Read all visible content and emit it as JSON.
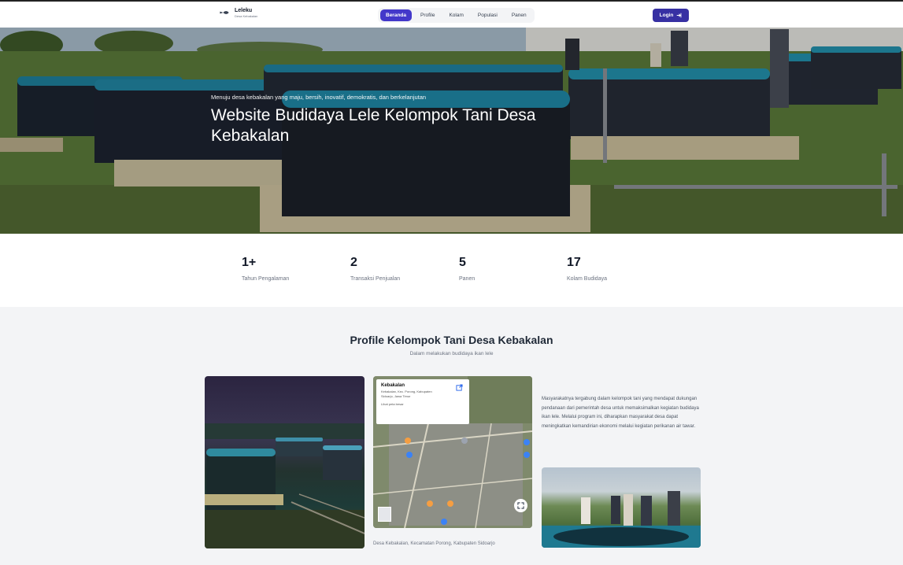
{
  "navbar": {
    "brand_name": "Leleku",
    "brand_sub": "Desa Kebakalan",
    "menu": [
      {
        "label": "Beranda",
        "active": true
      },
      {
        "label": "Profile",
        "active": false
      },
      {
        "label": "Kolam",
        "active": false
      },
      {
        "label": "Populasi",
        "active": false
      },
      {
        "label": "Panen",
        "active": false
      }
    ],
    "login_label": "Login",
    "accent_color": "#3730a3"
  },
  "hero": {
    "tagline": "Menuju desa kebakalan yang maju, bersih, inovatif, demokratis, dan berkelanjutan",
    "title": "Website Budidaya Lele Kelompok Tani Desa Kebakalan"
  },
  "stats": [
    {
      "value": "1+",
      "label": "Tahun Pengalaman"
    },
    {
      "value": "2",
      "label": "Transaksi Penjualan"
    },
    {
      "value": "5",
      "label": "Panen"
    },
    {
      "value": "17",
      "label": "Kolam Budidaya"
    }
  ],
  "profile": {
    "title": "Profile Kelompok Tani Desa Kebakalan",
    "subtitle": "Dalam melakukan budidaya ikan lele",
    "map": {
      "place_name": "Kebakalan",
      "address": "Kebakalan, Kec. Porong, Kabupaten Sidoarjo, Jawa Timur",
      "link_text": "Lihat peta besar"
    },
    "map_caption": "Desa Kebakalan, Kecamatan Porong, Kabupaten Sidoarjo",
    "description": "Masyarakatnya tergabung dalam kelompok tani yang mendapat dukungan pendanaan dari pemerintah desa untuk memaksimalkan kegiatan budidaya ikan lele. Melalui program ini, diharapkan masyarakat desa dapat meningkatkan kemandirian ekonomi melalui kegiatan perikanan air tawar."
  }
}
